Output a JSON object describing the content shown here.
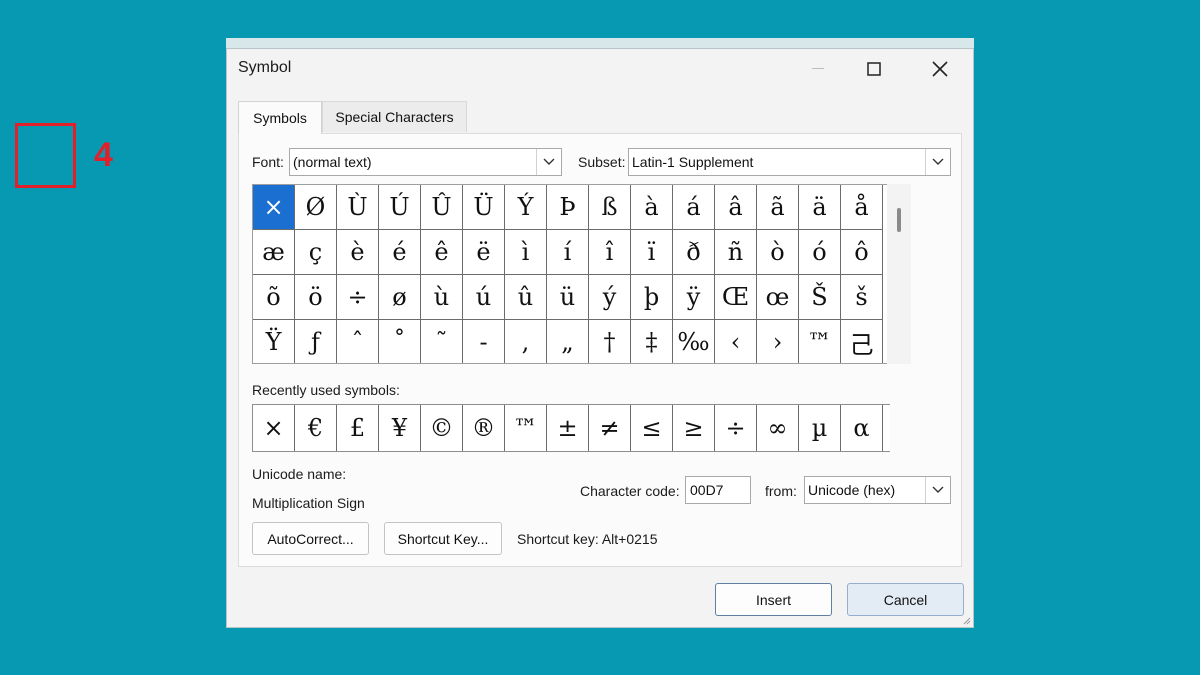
{
  "window": {
    "title": "Symbol"
  },
  "tabs": [
    {
      "label": "Symbols",
      "active": true
    },
    {
      "label": "Special Characters",
      "active": false
    }
  ],
  "font": {
    "label": "Font:",
    "value": "(normal text)"
  },
  "subset": {
    "label": "Subset:",
    "value": "Latin-1 Supplement"
  },
  "symbols_grid": {
    "rows": [
      [
        "×",
        "Ø",
        "Ù",
        "Ú",
        "Û",
        "Ü",
        "Ý",
        "Þ",
        "ß",
        "à",
        "á",
        "â",
        "ã",
        "ä",
        "å"
      ],
      [
        "æ",
        "ç",
        "è",
        "é",
        "ê",
        "ë",
        "ì",
        "í",
        "î",
        "ï",
        "ð",
        "ñ",
        "ò",
        "ó",
        "ô"
      ],
      [
        "õ",
        "ö",
        "÷",
        "ø",
        "ù",
        "ú",
        "û",
        "ü",
        "ý",
        "þ",
        "ÿ",
        "Œ",
        "œ",
        "Š",
        "š"
      ],
      [
        "Ÿ",
        "ƒ",
        "ˆ",
        "˚",
        "˜",
        "-",
        ",",
        "„",
        "†",
        "‡",
        "‰",
        "‹",
        "›",
        "™",
        "⼰"
      ]
    ],
    "selected": "×"
  },
  "recent": {
    "label": "Recently used symbols:",
    "symbols": [
      "×",
      "€",
      "£",
      "¥",
      "©",
      "®",
      "™",
      "±",
      "≠",
      "≤",
      "≥",
      "÷",
      "∞",
      "µ",
      "α"
    ]
  },
  "unicode_name": {
    "label": "Unicode name:",
    "value": "Multiplication Sign"
  },
  "character_code": {
    "label": "Character code:",
    "value": "00D7"
  },
  "from": {
    "label": "from:",
    "value": "Unicode (hex)"
  },
  "buttons": {
    "autocorrect": "AutoCorrect...",
    "shortcut_key": "Shortcut Key...",
    "insert": "Insert",
    "cancel": "Cancel"
  },
  "shortcut_text": "Shortcut key: Alt+0215",
  "annotation": {
    "step": "4"
  },
  "colors": {
    "background": "#0799b2",
    "selection": "#1a6fd1",
    "highlight": "#e3202a"
  }
}
